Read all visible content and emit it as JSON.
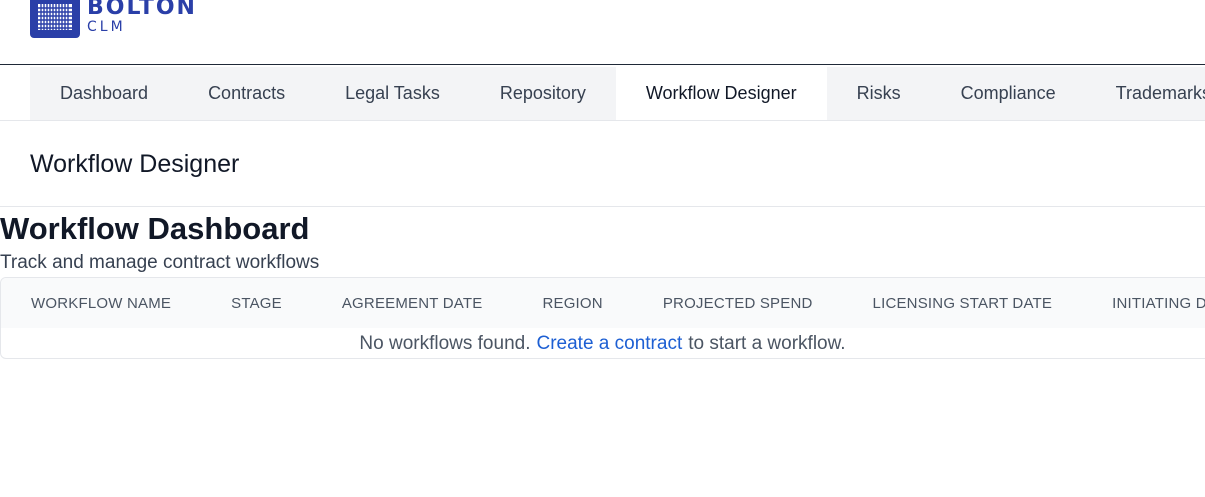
{
  "brand": {
    "name": "BOLTON",
    "subtitle": "CLM",
    "color": "#2a3fa8",
    "icon": "grid-logo-icon"
  },
  "nav": {
    "tabs": [
      {
        "label": "Dashboard",
        "active": false
      },
      {
        "label": "Contracts",
        "active": false
      },
      {
        "label": "Legal Tasks",
        "active": false
      },
      {
        "label": "Repository",
        "active": false
      },
      {
        "label": "Workflow Designer",
        "active": true
      },
      {
        "label": "Risks",
        "active": false
      },
      {
        "label": "Compliance",
        "active": false
      },
      {
        "label": "Trademarks",
        "active": false
      }
    ]
  },
  "page": {
    "title": "Workflow Designer"
  },
  "dashboard": {
    "heading": "Workflow Dashboard",
    "subheading": "Track and manage contract workflows"
  },
  "table": {
    "columns": [
      "WORKFLOW NAME",
      "STAGE",
      "AGREEMENT DATE",
      "REGION",
      "PROJECTED SPEND",
      "LICENSING START DATE",
      "INITIATING DEPARTMENT"
    ],
    "rows": [],
    "empty": {
      "before": "No workflows found.",
      "link": "Create a contract",
      "after": "to start a workflow.",
      "link_color": "#1d5fd3"
    }
  }
}
